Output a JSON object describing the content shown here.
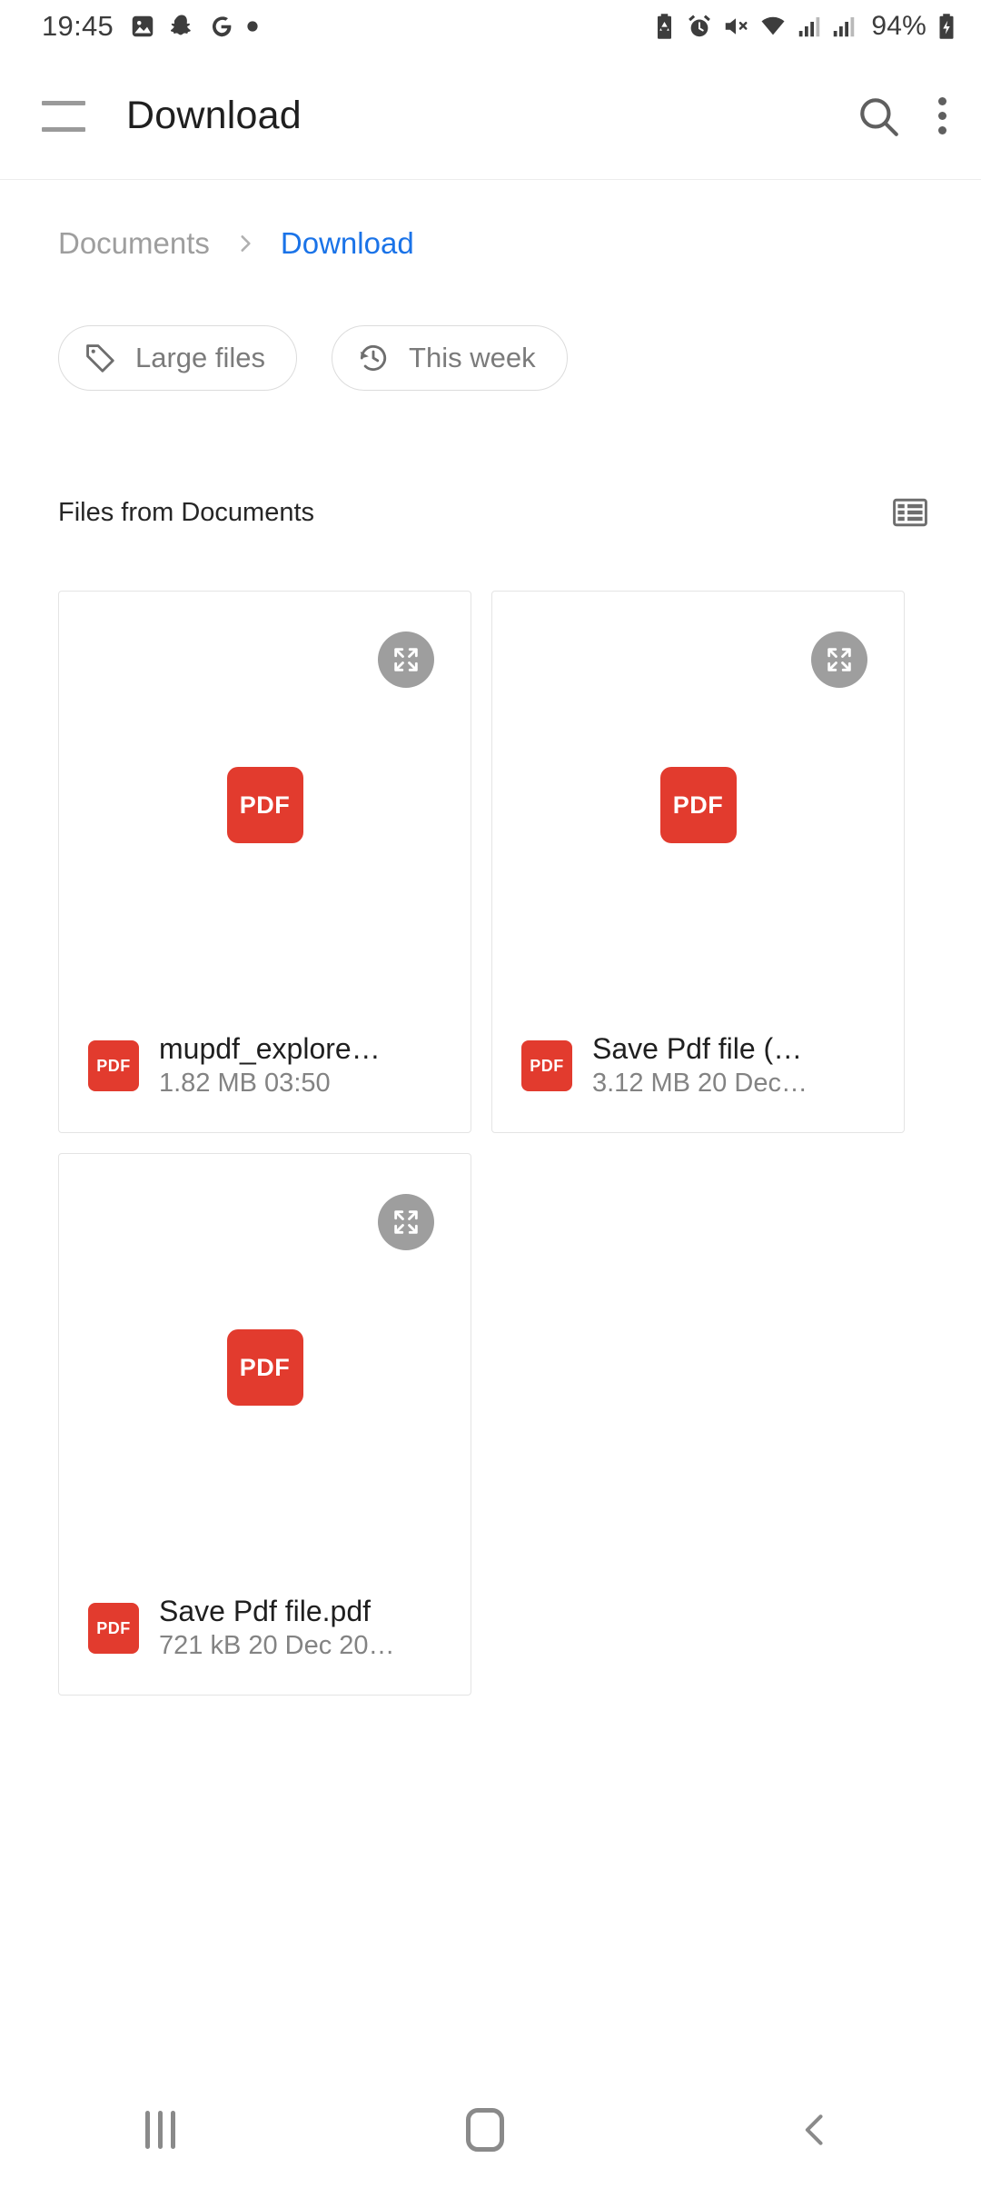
{
  "status_bar": {
    "time": "19:45",
    "left_icons": [
      "photos-icon",
      "snapchat-icon",
      "google-icon",
      "dot-icon"
    ],
    "right_icons": [
      "battery-saver-icon",
      "alarm-icon",
      "mute-icon",
      "wifi-icon",
      "signal-icon-1",
      "signal-icon-2"
    ],
    "battery_percent": "94%",
    "battery_state_icon": "battery-charging-icon"
  },
  "app_bar": {
    "menu_icon": "hamburger-menu-icon",
    "title": "Download",
    "search_icon": "search-icon",
    "overflow_icon": "more-vertical-icon"
  },
  "breadcrumb": {
    "parent": "Documents",
    "separator": "chevron-right-icon",
    "current": "Download"
  },
  "chips": [
    {
      "label": "Large files",
      "icon": "tag-icon"
    },
    {
      "label": "This week",
      "icon": "history-icon"
    }
  ],
  "section": {
    "title": "Files from Documents",
    "view_toggle_icon": "list-view-icon"
  },
  "files": [
    {
      "name": "mupdf_explore…",
      "subtitle": "1.82 MB 03:50",
      "type_label": "PDF",
      "thumb_icon": "pdf-file-icon",
      "expand_icon": "expand-icon"
    },
    {
      "name": "Save Pdf file (…",
      "subtitle": "3.12 MB 20 Dec…",
      "type_label": "PDF",
      "thumb_icon": "pdf-file-icon",
      "expand_icon": "expand-icon"
    },
    {
      "name": "Save Pdf file.pdf",
      "subtitle": "721 kB 20 Dec 20…",
      "type_label": "PDF",
      "thumb_icon": "pdf-file-icon",
      "expand_icon": "expand-icon"
    }
  ],
  "nav_bar": {
    "recents": "recents-icon",
    "home": "home-icon",
    "back": "back-icon"
  },
  "colors": {
    "accent": "#1a73e8",
    "pdf_red": "#e23b2e",
    "text_primary": "#1f1f1f",
    "text_secondary": "#838383"
  }
}
